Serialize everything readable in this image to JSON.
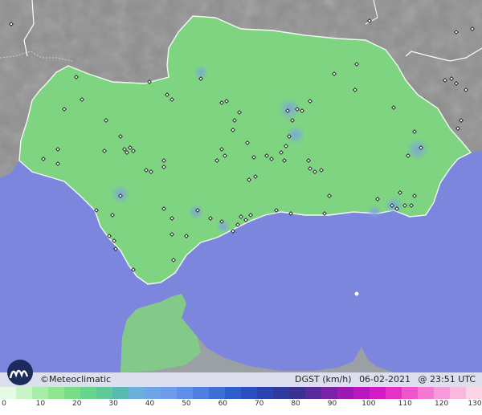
{
  "credit": "©Meteoclimatic",
  "caption": {
    "variable": "DGST (km/h)",
    "date": "06-02-2021",
    "time": "@ 23:51 UTC"
  },
  "legend": {
    "ticks": [
      "0",
      "10",
      "20",
      "30",
      "40",
      "50",
      "60",
      "70",
      "80",
      "90",
      "100",
      "110",
      "120",
      "130"
    ],
    "colors": [
      "#e6fbe6",
      "#c8f5c8",
      "#a8eea8",
      "#8ee68e",
      "#78de86",
      "#68d48c",
      "#5fca98",
      "#5ab9b0",
      "#6ab0d8",
      "#6fa6e8",
      "#6e9bee",
      "#5f8fe8",
      "#4f7fe0",
      "#3d6fd6",
      "#2f5fcc",
      "#2a4fbf",
      "#2a43ae",
      "#2e3a9c",
      "#3a3290",
      "#582a9a",
      "#7a22a6",
      "#9a1ab2",
      "#b818bd",
      "#d21ac5",
      "#e431c6",
      "#ee55cc",
      "#f478d4",
      "#f79ad9",
      "#f9b9de",
      "#fbd4e6"
    ]
  },
  "map": {
    "sea_color": "#7c86dd",
    "land_color": "#7bd27e",
    "foreign_land_color": "#8a8a8a",
    "border_color": "#ffffff"
  }
}
